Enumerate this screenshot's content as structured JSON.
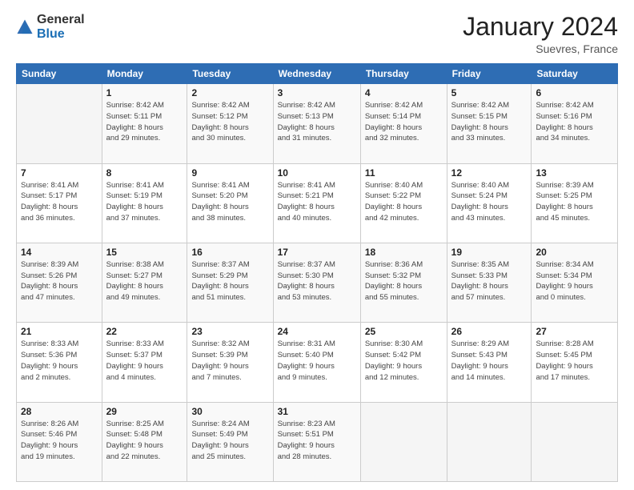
{
  "header": {
    "logo": {
      "general": "General",
      "blue": "Blue"
    },
    "month": "January 2024",
    "location": "Suevres, France"
  },
  "days_of_week": [
    "Sunday",
    "Monday",
    "Tuesday",
    "Wednesday",
    "Thursday",
    "Friday",
    "Saturday"
  ],
  "weeks": [
    [
      {
        "day": "",
        "info": ""
      },
      {
        "day": "1",
        "info": "Sunrise: 8:42 AM\nSunset: 5:11 PM\nDaylight: 8 hours\nand 29 minutes."
      },
      {
        "day": "2",
        "info": "Sunrise: 8:42 AM\nSunset: 5:12 PM\nDaylight: 8 hours\nand 30 minutes."
      },
      {
        "day": "3",
        "info": "Sunrise: 8:42 AM\nSunset: 5:13 PM\nDaylight: 8 hours\nand 31 minutes."
      },
      {
        "day": "4",
        "info": "Sunrise: 8:42 AM\nSunset: 5:14 PM\nDaylight: 8 hours\nand 32 minutes."
      },
      {
        "day": "5",
        "info": "Sunrise: 8:42 AM\nSunset: 5:15 PM\nDaylight: 8 hours\nand 33 minutes."
      },
      {
        "day": "6",
        "info": "Sunrise: 8:42 AM\nSunset: 5:16 PM\nDaylight: 8 hours\nand 34 minutes."
      }
    ],
    [
      {
        "day": "7",
        "info": "Sunrise: 8:41 AM\nSunset: 5:17 PM\nDaylight: 8 hours\nand 36 minutes."
      },
      {
        "day": "8",
        "info": "Sunrise: 8:41 AM\nSunset: 5:19 PM\nDaylight: 8 hours\nand 37 minutes."
      },
      {
        "day": "9",
        "info": "Sunrise: 8:41 AM\nSunset: 5:20 PM\nDaylight: 8 hours\nand 38 minutes."
      },
      {
        "day": "10",
        "info": "Sunrise: 8:41 AM\nSunset: 5:21 PM\nDaylight: 8 hours\nand 40 minutes."
      },
      {
        "day": "11",
        "info": "Sunrise: 8:40 AM\nSunset: 5:22 PM\nDaylight: 8 hours\nand 42 minutes."
      },
      {
        "day": "12",
        "info": "Sunrise: 8:40 AM\nSunset: 5:24 PM\nDaylight: 8 hours\nand 43 minutes."
      },
      {
        "day": "13",
        "info": "Sunrise: 8:39 AM\nSunset: 5:25 PM\nDaylight: 8 hours\nand 45 minutes."
      }
    ],
    [
      {
        "day": "14",
        "info": "Sunrise: 8:39 AM\nSunset: 5:26 PM\nDaylight: 8 hours\nand 47 minutes."
      },
      {
        "day": "15",
        "info": "Sunrise: 8:38 AM\nSunset: 5:27 PM\nDaylight: 8 hours\nand 49 minutes."
      },
      {
        "day": "16",
        "info": "Sunrise: 8:37 AM\nSunset: 5:29 PM\nDaylight: 8 hours\nand 51 minutes."
      },
      {
        "day": "17",
        "info": "Sunrise: 8:37 AM\nSunset: 5:30 PM\nDaylight: 8 hours\nand 53 minutes."
      },
      {
        "day": "18",
        "info": "Sunrise: 8:36 AM\nSunset: 5:32 PM\nDaylight: 8 hours\nand 55 minutes."
      },
      {
        "day": "19",
        "info": "Sunrise: 8:35 AM\nSunset: 5:33 PM\nDaylight: 8 hours\nand 57 minutes."
      },
      {
        "day": "20",
        "info": "Sunrise: 8:34 AM\nSunset: 5:34 PM\nDaylight: 9 hours\nand 0 minutes."
      }
    ],
    [
      {
        "day": "21",
        "info": "Sunrise: 8:33 AM\nSunset: 5:36 PM\nDaylight: 9 hours\nand 2 minutes."
      },
      {
        "day": "22",
        "info": "Sunrise: 8:33 AM\nSunset: 5:37 PM\nDaylight: 9 hours\nand 4 minutes."
      },
      {
        "day": "23",
        "info": "Sunrise: 8:32 AM\nSunset: 5:39 PM\nDaylight: 9 hours\nand 7 minutes."
      },
      {
        "day": "24",
        "info": "Sunrise: 8:31 AM\nSunset: 5:40 PM\nDaylight: 9 hours\nand 9 minutes."
      },
      {
        "day": "25",
        "info": "Sunrise: 8:30 AM\nSunset: 5:42 PM\nDaylight: 9 hours\nand 12 minutes."
      },
      {
        "day": "26",
        "info": "Sunrise: 8:29 AM\nSunset: 5:43 PM\nDaylight: 9 hours\nand 14 minutes."
      },
      {
        "day": "27",
        "info": "Sunrise: 8:28 AM\nSunset: 5:45 PM\nDaylight: 9 hours\nand 17 minutes."
      }
    ],
    [
      {
        "day": "28",
        "info": "Sunrise: 8:26 AM\nSunset: 5:46 PM\nDaylight: 9 hours\nand 19 minutes."
      },
      {
        "day": "29",
        "info": "Sunrise: 8:25 AM\nSunset: 5:48 PM\nDaylight: 9 hours\nand 22 minutes."
      },
      {
        "day": "30",
        "info": "Sunrise: 8:24 AM\nSunset: 5:49 PM\nDaylight: 9 hours\nand 25 minutes."
      },
      {
        "day": "31",
        "info": "Sunrise: 8:23 AM\nSunset: 5:51 PM\nDaylight: 9 hours\nand 28 minutes."
      },
      {
        "day": "",
        "info": ""
      },
      {
        "day": "",
        "info": ""
      },
      {
        "day": "",
        "info": ""
      }
    ]
  ]
}
